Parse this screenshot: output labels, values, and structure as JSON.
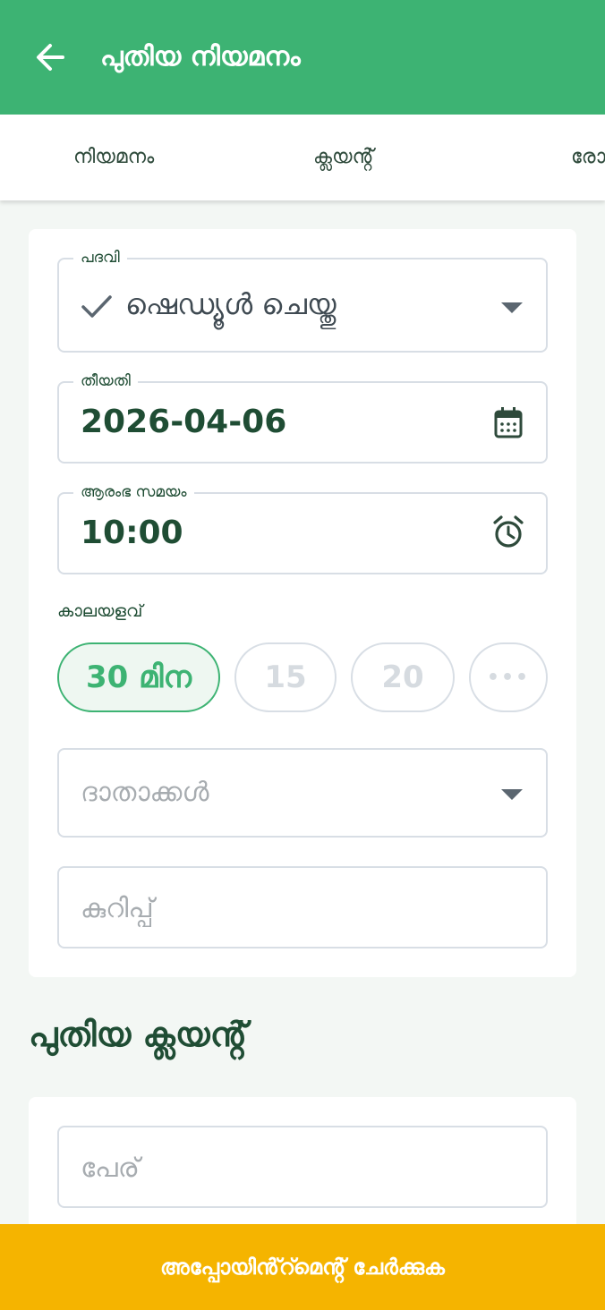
{
  "app_bar": {
    "title": "പുതിയ നിയമനം",
    "back_icon": "arrow-left-icon"
  },
  "tabs": [
    {
      "label": "നിയമനം"
    },
    {
      "label": "ക്ലയൻ്റ്"
    },
    {
      "label": "രോ"
    }
  ],
  "form": {
    "status": {
      "label": "പദവി",
      "value": "ഷെഡ്യൂൾ ചെയ്തു"
    },
    "date": {
      "label": "തീയതി",
      "value": "2026-04-06"
    },
    "start_time": {
      "label": "ആരംഭ സമയം",
      "value": "10:00"
    },
    "duration": {
      "label": "കാലയളവ്",
      "chips": [
        {
          "label": "30 മിന",
          "selected": true
        },
        {
          "label": "15",
          "selected": false
        },
        {
          "label": "20",
          "selected": false
        },
        {
          "label": "•••",
          "selected": false
        }
      ]
    },
    "providers": {
      "placeholder": "ദാതാക്കൾ"
    },
    "notes": {
      "placeholder": "കുറിപ്പ്"
    }
  },
  "new_client": {
    "heading": "പുതിയ ക്ലയൻ്റ്",
    "name": {
      "placeholder": "പേര്"
    }
  },
  "footer": {
    "button_label": "അപ്പോയിൻ്റ്മെൻ്റ് ചേർക്കുക"
  },
  "colors": {
    "primary": "#3db373",
    "accent": "#f5b400",
    "text_dark": "#1f4d34",
    "border": "#d8dee5"
  }
}
